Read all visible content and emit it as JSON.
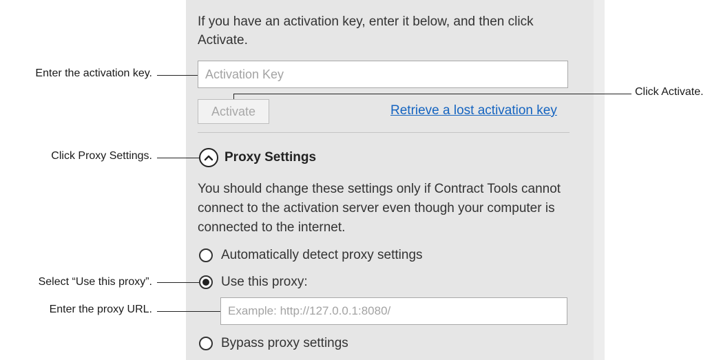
{
  "activation": {
    "intro_text": "If you have an activation key, enter it below, and then click Activate.",
    "key_placeholder": "Activation Key",
    "activate_label": "Activate",
    "retrieve_link": "Retrieve a lost activation key"
  },
  "proxy": {
    "title": "Proxy Settings",
    "description": "You should change these settings only if Contract Tools cannot connect to the activation server even though your computer is connected to the internet.",
    "options": [
      {
        "label": "Automatically detect proxy settings",
        "selected": false
      },
      {
        "label": "Use this proxy:",
        "selected": true
      },
      {
        "label": "Bypass proxy settings",
        "selected": false
      }
    ],
    "url_placeholder": "Example: http://127.0.0.1:8080/"
  },
  "callouts": {
    "enter_key": "Enter the activation key.",
    "click_activate": "Click Activate.",
    "click_proxy": "Click Proxy Settings.",
    "select_proxy": "Select “Use this proxy”.",
    "enter_url": "Enter the proxy URL."
  },
  "icons": {
    "expand": "chevron-up-icon"
  }
}
